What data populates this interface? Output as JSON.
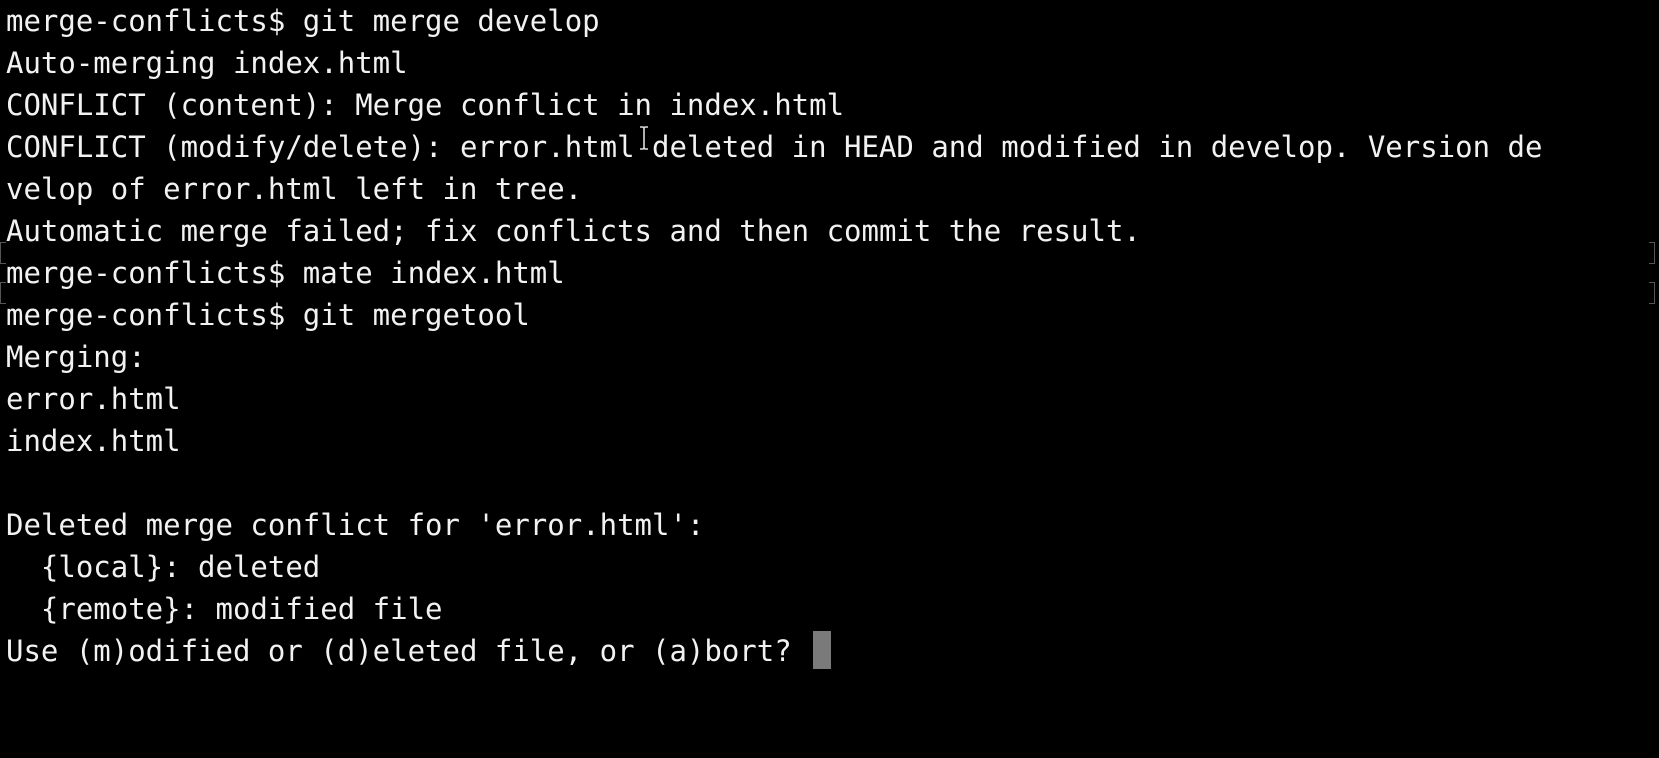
{
  "terminal": {
    "lines": [
      "merge-conflicts$ git merge develop",
      "Auto-merging index.html",
      "CONFLICT (content): Merge conflict in index.html",
      "CONFLICT (modify/delete): error.html deleted in HEAD and modified in develop. Version de",
      "velop of error.html left in tree.",
      "Automatic merge failed; fix conflicts and then commit the result.",
      "merge-conflicts$ mate index.html",
      "merge-conflicts$ git mergetool",
      "Merging:",
      "error.html",
      "index.html",
      "",
      "Deleted merge conflict for 'error.html':",
      "  {local}: deleted",
      "  {remote}: modified file"
    ],
    "prompt_line": "Use (m)odified or (d)eleted file, or (a)bort? ",
    "cursor_color": "#7a7a7a",
    "text_color": "#f2f2f2",
    "background_color": "#000000",
    "mouse_cursor_icon": "ibeam-cursor-icon"
  }
}
